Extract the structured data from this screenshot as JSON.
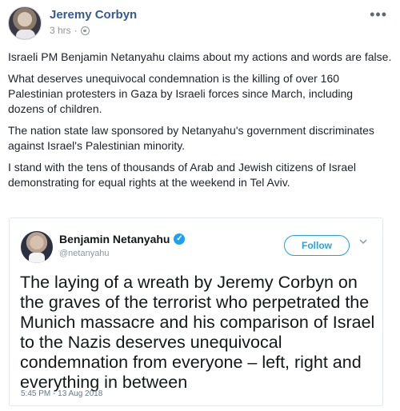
{
  "post": {
    "author": "Jeremy Corbyn",
    "time": "3 hrs",
    "separator": "·",
    "more_icon": "more-dots-icon",
    "paragraphs": [
      "Israeli PM Benjamin Netanyahu claims about my actions and words are false.",
      "What deserves unequivocal condemnation is the killing of over 160 Palestinian protesters in Gaza by Israeli forces since March, including dozens of children.",
      "The nation state law sponsored by Netanyahu's government discriminates against Israel's Palestinian minority.",
      "I stand with the tens of thousands of Arab and Jewish citizens of Israel demonstrating for equal rights at the weekend in Tel Aviv."
    ]
  },
  "tweet": {
    "name": "Benjamin Netanyahu",
    "handle": "@netanyahu",
    "follow_label": "Follow",
    "text": "The laying of a wreath by Jeremy Corbyn on the graves of the terrorist who perpetrated the Munich massacre and his comparison of Israel to the Nazis deserves unequivocal condemnation from everyone – left, right and everything in between",
    "timestamp": "5:45 PM - 13 Aug 2018"
  },
  "colors": {
    "facebook_link": "#365899",
    "twitter_blue": "#1da1f2"
  }
}
